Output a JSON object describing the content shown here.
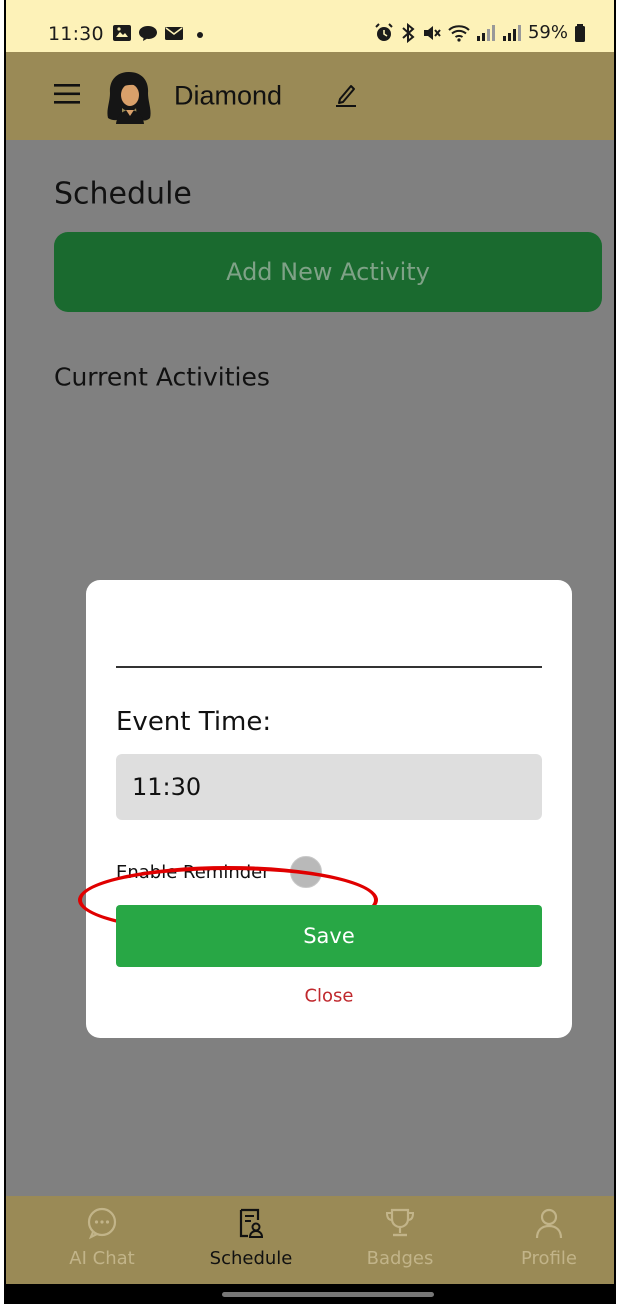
{
  "status_bar": {
    "time": "11:30",
    "battery": "59%"
  },
  "header": {
    "user_name": "Diamond"
  },
  "main": {
    "title": "Schedule",
    "add_button_label": "Add New Activity",
    "current_heading": "Current Activities"
  },
  "modal": {
    "name_value": "",
    "event_time_label": "Event Time:",
    "event_time_value": "11:30",
    "reminder_label": "Enable Reminder",
    "reminder_enabled": false,
    "save_label": "Save",
    "close_label": "Close"
  },
  "bottom_nav": {
    "items": [
      {
        "label": "AI Chat",
        "icon": "chat-icon",
        "active": false
      },
      {
        "label": "Schedule",
        "icon": "schedule-icon",
        "active": true
      },
      {
        "label": "Badges",
        "icon": "trophy-icon",
        "active": false
      },
      {
        "label": "Profile",
        "icon": "profile-icon",
        "active": false
      }
    ]
  },
  "colors": {
    "app_bar": "#9a8a56",
    "status_bar": "#fdf2b8",
    "add_button": "#1a6a2f",
    "save_button": "#28a745",
    "close_text": "#c0282d",
    "highlight": "#e00000"
  }
}
